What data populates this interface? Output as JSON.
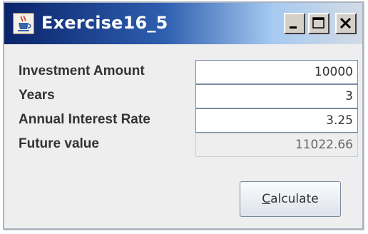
{
  "window": {
    "title": "Exercise16_5",
    "icon": "java-cup-icon",
    "controls": [
      "minimize-icon",
      "maximize-icon",
      "close-icon"
    ]
  },
  "form": {
    "rows": [
      {
        "label": "Investment Amount",
        "value": "10000",
        "editable": true
      },
      {
        "label": "Years",
        "value": "3",
        "editable": true
      },
      {
        "label": "Annual Interest Rate",
        "value": "3.25",
        "editable": true
      },
      {
        "label": "Future value",
        "value": "11022.66",
        "editable": false
      }
    ]
  },
  "button": {
    "mnemonic": "C",
    "rest": "alculate"
  },
  "colors": {
    "titlebar_start": "#0a246a",
    "titlebar_end": "#d4dbe6",
    "background": "#eeeeee"
  }
}
